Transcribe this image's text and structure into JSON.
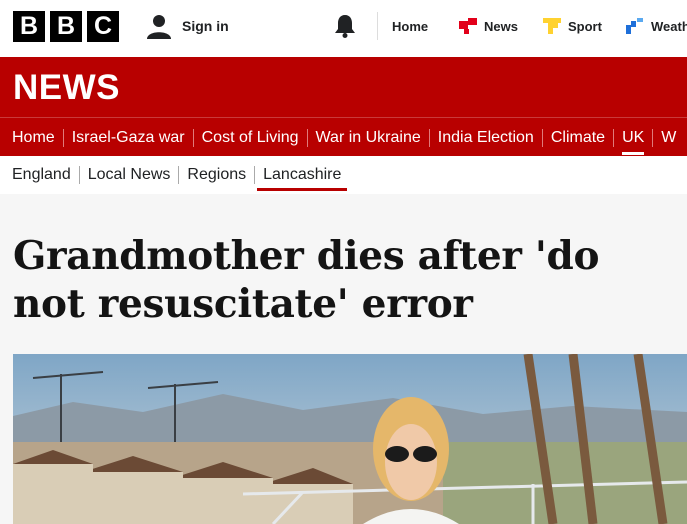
{
  "header": {
    "logo_letters": [
      "B",
      "B",
      "C"
    ],
    "signin_label": "Sign in",
    "nav": [
      {
        "label": "Home",
        "icon": "none"
      },
      {
        "label": "News",
        "icon": "news-icon",
        "color": "#e2001a"
      },
      {
        "label": "Sport",
        "icon": "sport-icon",
        "color": "#ffd230"
      },
      {
        "label": "Weath",
        "icon": "weather-icon",
        "color": "#1e6fd9"
      }
    ]
  },
  "banner": {
    "title": "NEWS"
  },
  "primary_nav": [
    {
      "label": "Home"
    },
    {
      "label": "Israel-Gaza war"
    },
    {
      "label": "Cost of Living"
    },
    {
      "label": "War in Ukraine"
    },
    {
      "label": "India Election"
    },
    {
      "label": "Climate"
    },
    {
      "label": "UK",
      "active": true
    },
    {
      "label": "W"
    }
  ],
  "secondary_nav": [
    {
      "label": "England"
    },
    {
      "label": "Local News"
    },
    {
      "label": "Regions"
    },
    {
      "label": "Lancashire",
      "active": true
    }
  ],
  "article": {
    "headline": "Grandmother dies after 'do not resuscitate' error"
  },
  "colors": {
    "brand_red": "#b80000",
    "headline": "#141414"
  }
}
